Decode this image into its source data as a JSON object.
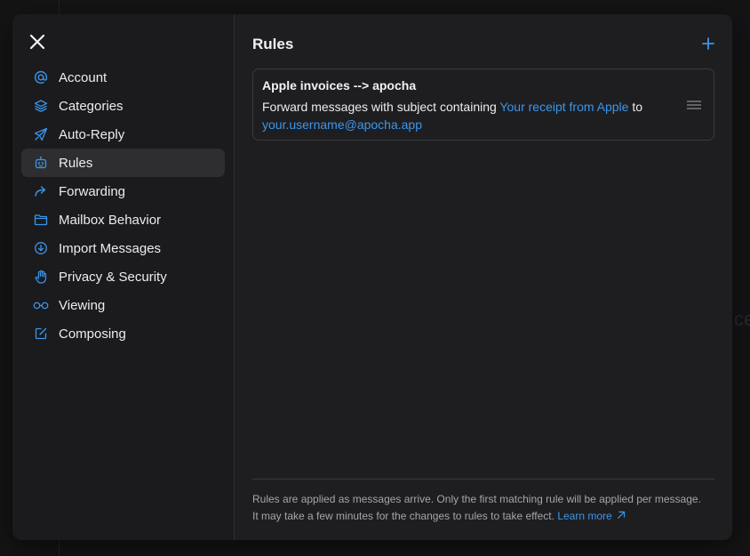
{
  "colors": {
    "accent": "#3a96ec",
    "background": "#1e1e20",
    "sidebar": "#1b1b1d",
    "active_item": "#2e2e31"
  },
  "backdrop": {
    "fragment": "ce"
  },
  "sidebar": {
    "close_icon": "close-icon",
    "items": [
      {
        "label": "Account",
        "icon": "at-icon",
        "active": false
      },
      {
        "label": "Categories",
        "icon": "layers-icon",
        "active": false
      },
      {
        "label": "Auto-Reply",
        "icon": "paper-plane-icon",
        "active": false
      },
      {
        "label": "Rules",
        "icon": "robot-icon",
        "active": true
      },
      {
        "label": "Forwarding",
        "icon": "forward-arrow-icon",
        "active": false
      },
      {
        "label": "Mailbox Behavior",
        "icon": "folder-icon",
        "active": false
      },
      {
        "label": "Import Messages",
        "icon": "download-circle-icon",
        "active": false
      },
      {
        "label": "Privacy & Security",
        "icon": "hand-icon",
        "active": false
      },
      {
        "label": "Viewing",
        "icon": "glasses-icon",
        "active": false
      },
      {
        "label": "Composing",
        "icon": "compose-icon",
        "active": false
      }
    ]
  },
  "main": {
    "title": "Rules",
    "add_icon": "plus-icon",
    "rules": [
      {
        "name": "Apple invoices --> apocha",
        "desc_prefix": "Forward messages with subject containing ",
        "subject_value": "Your receipt from Apple",
        "desc_middle": " to",
        "forward_address": "your.username@apocha.app",
        "handle_icon": "drag-handle-icon"
      }
    ],
    "footer": {
      "text": "Rules are applied as messages arrive. Only the first matching rule will be applied per message. It may take a few minutes for the changes to rules to take effect.",
      "learn_more": "Learn more",
      "learn_more_icon": "external-arrow-icon"
    }
  }
}
